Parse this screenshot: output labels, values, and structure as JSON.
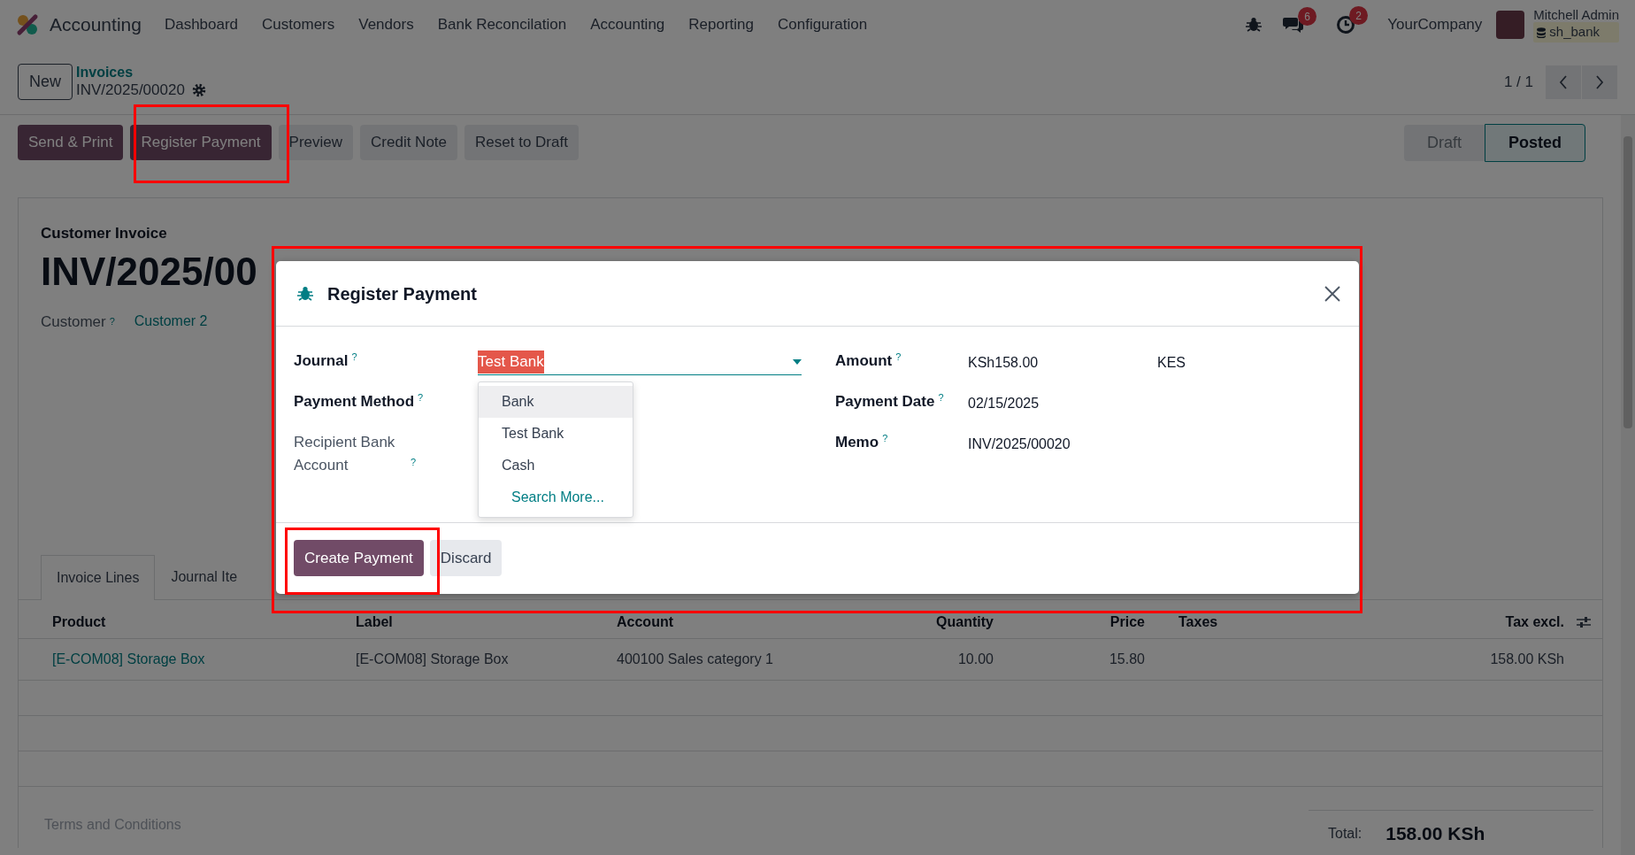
{
  "navbar": {
    "app_name": "Accounting",
    "menu": [
      "Dashboard",
      "Customers",
      "Vendors",
      "Bank Reconcilation",
      "Accounting",
      "Reporting",
      "Configuration"
    ],
    "messages_count": "6",
    "activities_count": "2",
    "company": "YourCompany",
    "user_name": "Mitchell Admin",
    "database": "sh_bank"
  },
  "control_panel": {
    "new_button": "New",
    "breadcrumb": "Invoices",
    "record": "INV/2025/00020",
    "pager": "1 / 1"
  },
  "action_buttons": [
    {
      "label": "Send & Print",
      "kind": "primary"
    },
    {
      "label": "Register Payment",
      "kind": "primary"
    },
    {
      "label": "Preview",
      "kind": "secondary"
    },
    {
      "label": "Credit Note",
      "kind": "secondary"
    },
    {
      "label": "Reset to Draft",
      "kind": "secondary"
    }
  ],
  "status_bar": [
    {
      "label": "Draft",
      "selected": false
    },
    {
      "label": "Posted",
      "selected": true
    }
  ],
  "form": {
    "type_label": "Customer Invoice",
    "name": "INV/2025/00",
    "customer_label": "Customer",
    "customer_help": "?",
    "customer": "Customer 2"
  },
  "tabs": [
    {
      "label": "Invoice Lines",
      "selected": true
    },
    {
      "label": "Journal Ite",
      "selected": false
    }
  ],
  "table": {
    "columns": [
      "Product",
      "Label",
      "Account",
      "Quantity",
      "Price",
      "Taxes",
      "Tax excl."
    ],
    "rows": [
      {
        "product": "[E-COM08] Storage Box",
        "label": "[E-COM08] Storage Box",
        "account": "400100 Sales category 1",
        "quantity": "10.00",
        "price": "15.80",
        "tax_excl": "158.00 KSh"
      }
    ]
  },
  "terms_placeholder": "Terms and Conditions",
  "total": {
    "label": "Total:",
    "value": "158.00 KSh"
  },
  "dialog": {
    "title": "Register Payment",
    "left_fields": [
      {
        "label": "Journal",
        "help": "?",
        "kind": "select",
        "value": "Test Bank",
        "text_selected": true,
        "disabled": false
      },
      {
        "label": "Payment Method",
        "help": "?",
        "kind": "empty",
        "disabled": false
      },
      {
        "label": "Recipient Bank Account",
        "help": "?",
        "kind": "empty",
        "disabled": true
      }
    ],
    "right_fields": [
      {
        "label": "Amount",
        "help": "?",
        "value": "KSh158.00",
        "currency": "KES"
      },
      {
        "label": "Payment Date",
        "help": "?",
        "value": "02/15/2025"
      },
      {
        "label": "Memo",
        "help": "?",
        "value": "INV/2025/00020"
      }
    ],
    "journal_options": [
      {
        "label": "Bank",
        "kind": "option",
        "selected": true
      },
      {
        "label": "Test Bank",
        "kind": "option",
        "selected": false
      },
      {
        "label": "Cash",
        "kind": "option",
        "selected": false
      },
      {
        "label": "Search More...",
        "kind": "action",
        "selected": false
      }
    ],
    "buttons": [
      {
        "label": "Create Payment",
        "kind": "primary"
      },
      {
        "label": "Discard",
        "kind": "secondary"
      }
    ]
  },
  "annotations": [
    {
      "color": "#ff0000"
    },
    {
      "color": "#ff0000"
    },
    {
      "color": "#ff0000"
    }
  ]
}
